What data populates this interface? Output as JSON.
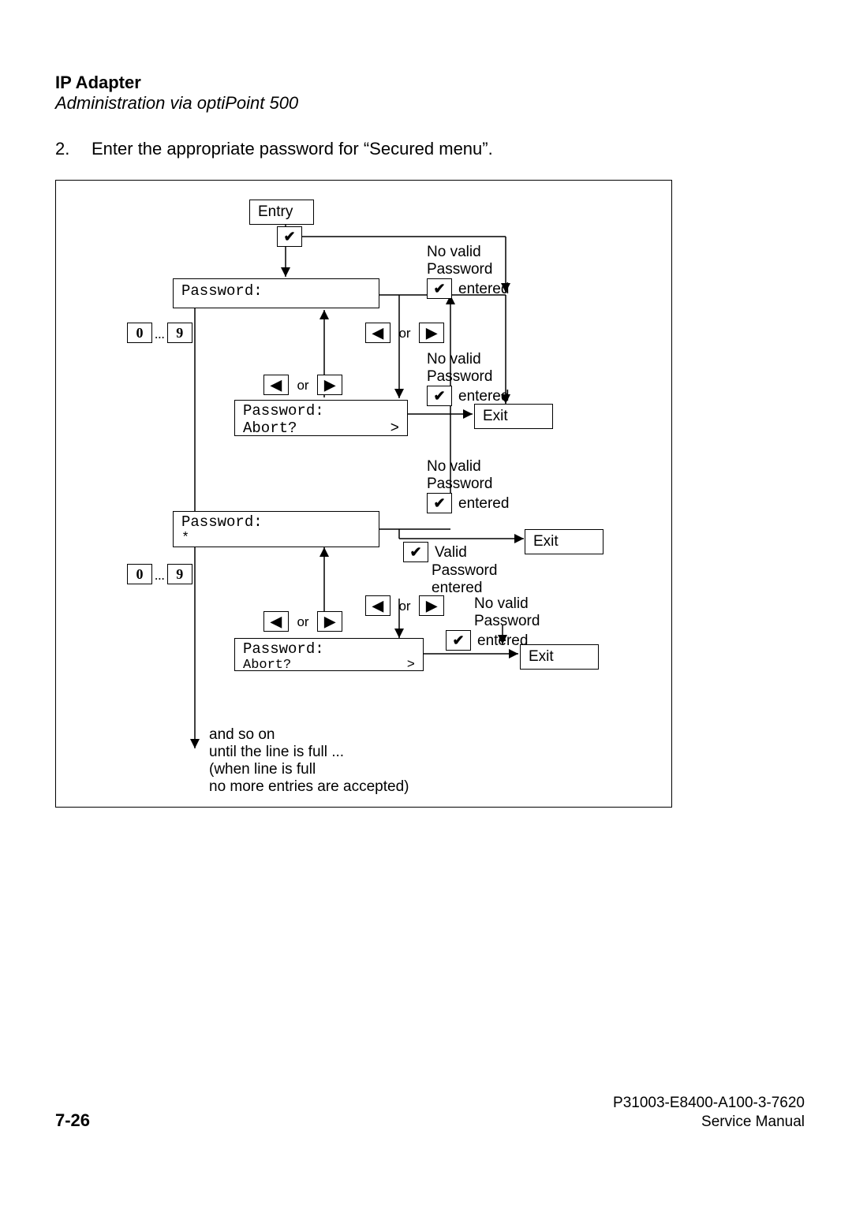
{
  "header": {
    "title": "IP Adapter",
    "subtitle": "Administration via optiPoint 500"
  },
  "step": {
    "number": "2.",
    "text": "Enter the appropriate password for “Secured menu”."
  },
  "diagram": {
    "entry": "Entry",
    "check": "✔",
    "left_arrow": "◀",
    "right_arrow": "▶",
    "gt": ">",
    "or": "or",
    "digits": {
      "zero": "0",
      "nine": "9",
      "sep": "..."
    },
    "no_valid_password_entered_l1": "No valid",
    "no_valid_password_entered_l2": "Password",
    "no_valid_password_entered_l3": "entered",
    "valid_password_l1": "Valid",
    "valid_password_l2": "Password",
    "valid_password_l3": "entered",
    "password_label": "Password:",
    "password_star": "*",
    "abort_label": "Abort?",
    "exit": "Exit",
    "note_l1": "and so on",
    "note_l2": "until the line is full ...",
    "note_l3": "(when line is full",
    "note_l4": "no more entries are accepted)"
  },
  "footer": {
    "page": "7-26",
    "docnum": "P31003-E8400-A100-3-7620",
    "manual": "Service Manual"
  }
}
